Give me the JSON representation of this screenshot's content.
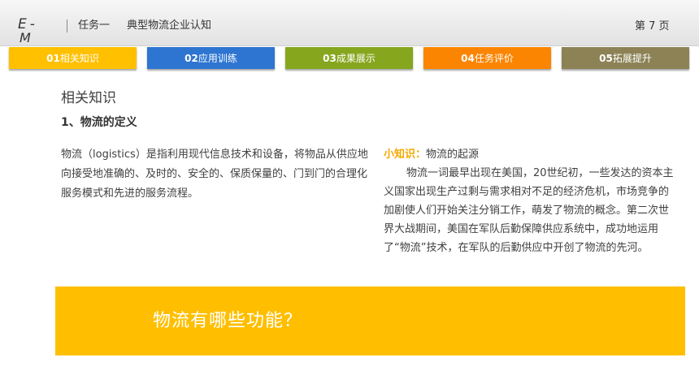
{
  "header": {
    "logo_line1": "E-",
    "logo_line2": "M",
    "task": "任务一",
    "title": "典型物流企业认知",
    "page": "第 7 页"
  },
  "tabs": [
    {
      "num": "01",
      "label": "相关知识",
      "color": "#ffc000"
    },
    {
      "num": "02",
      "label": "应用训练",
      "color": "#2e75d2"
    },
    {
      "num": "03",
      "label": "成果展示",
      "color": "#86a61e"
    },
    {
      "num": "04",
      "label": "任务评价",
      "color": "#fb8500"
    },
    {
      "num": "05",
      "label": "拓展提升",
      "color": "#8c8256"
    }
  ],
  "content": {
    "section_title": "相关知识",
    "subtitle": "1、物流的定义",
    "definition": "物流（logistics）是指利用现代信息技术和设备，将物品从供应地向接受地准确的、及时的、安全的、保质保量的、门到门的合理化服务模式和先进的服务流程。",
    "tip_label": "小知识：",
    "tip_title": "物流的起源",
    "tip_body": "物流一词最早出现在美国，20世纪初，一些发达的资本主义国家出现生产过剩与需求相对不足的经济危机，市场竞争的加剧使人们开始关注分销工作，萌发了物流的概念。第二次世界大战期间，美国在军队后勤保障供应系统中，成功地运用了“物流”技术，在军队的后勤供应中开创了物流的先河。"
  },
  "question": "物流有哪些功能？"
}
